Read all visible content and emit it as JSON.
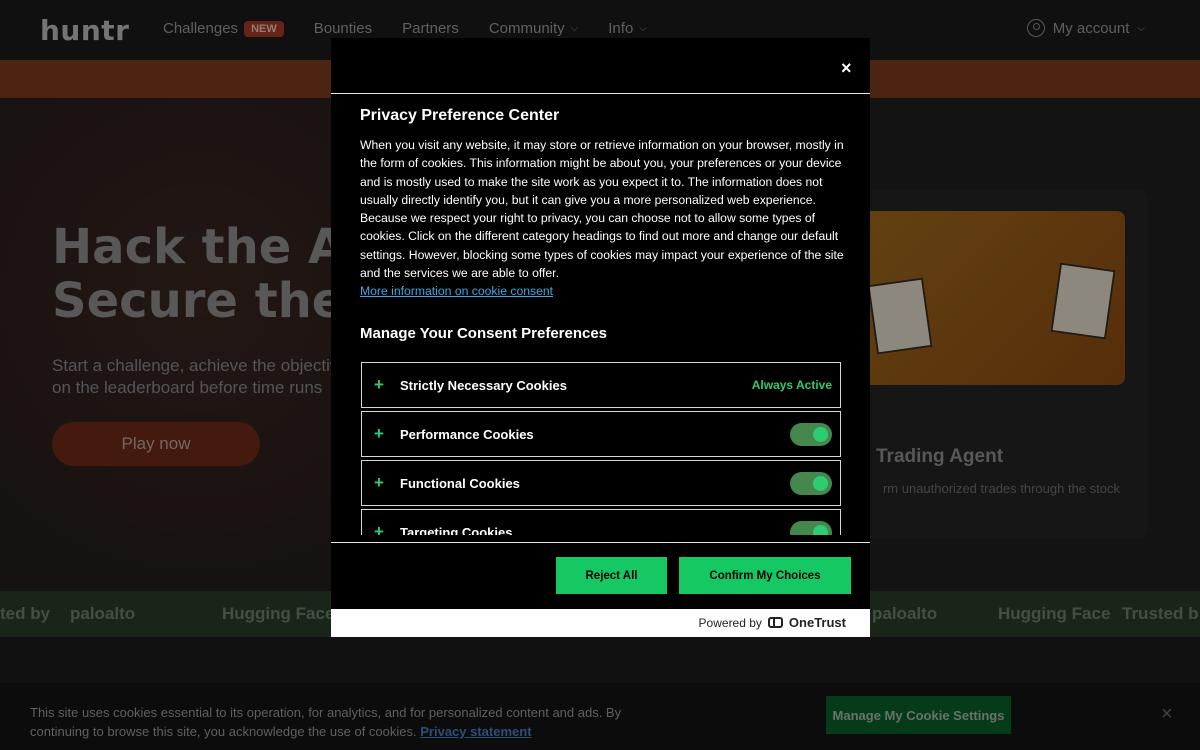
{
  "site": {
    "logo": "huntr",
    "nav": [
      {
        "label": "Challenges",
        "badge": "NEW"
      },
      {
        "label": "Bounties"
      },
      {
        "label": "Partners"
      },
      {
        "label": "Community"
      },
      {
        "label": "Info"
      }
    ],
    "account_label": "My account",
    "hero_title_line1": "Hack the AI,",
    "hero_title_line2": "Secure the F",
    "hero_sub_line1": "Start a challenge, achieve the objectiv",
    "hero_sub_line2": "on the leaderboard before time runs",
    "play_label": "Play now",
    "card_title": "Trading Agent",
    "card_desc": "rm unauthorized trades through the stock",
    "trusted": [
      "ted by",
      "paloalto",
      "Hugging Face",
      "paloalto",
      "Hugging Face",
      "Trusted b"
    ]
  },
  "modal": {
    "title": "Privacy Preference Center",
    "description": "When you visit any website, it may store or retrieve information on your browser, mostly in the form of cookies. This information might be about you, your preferences or your device and is mostly used to make the site work as you expect it to. The information does not usually directly identify you, but it can give you a more personalized web experience. Because we respect your right to privacy, you can choose not to allow some types of cookies. Click on the different category headings to find out more and change our default settings. However, blocking some types of cookies may impact your experience of the site and the services we are able to offer.",
    "more_info_link": "More information on cookie consent",
    "manage_title": "Manage Your Consent Preferences",
    "categories": [
      {
        "name": "Strictly Necessary Cookies",
        "status": "Always Active"
      },
      {
        "name": "Performance Cookies",
        "enabled": true
      },
      {
        "name": "Functional Cookies",
        "enabled": true
      },
      {
        "name": "Targeting Cookies",
        "enabled": true
      }
    ],
    "reject_label": "Reject All",
    "confirm_label": "Confirm My Choices",
    "powered_by": "Powered by",
    "powered_brand": "OneTrust",
    "close_glyph": "×"
  },
  "cookie_bar": {
    "text": "This site uses cookies essential to its operation, for analytics, and for personalized content and ads. By continuing to browse this site, you acknowledge the use of cookies.",
    "privacy_link": "Privacy statement",
    "manage_label": "Manage My Cookie Settings",
    "close_glyph": "×"
  }
}
